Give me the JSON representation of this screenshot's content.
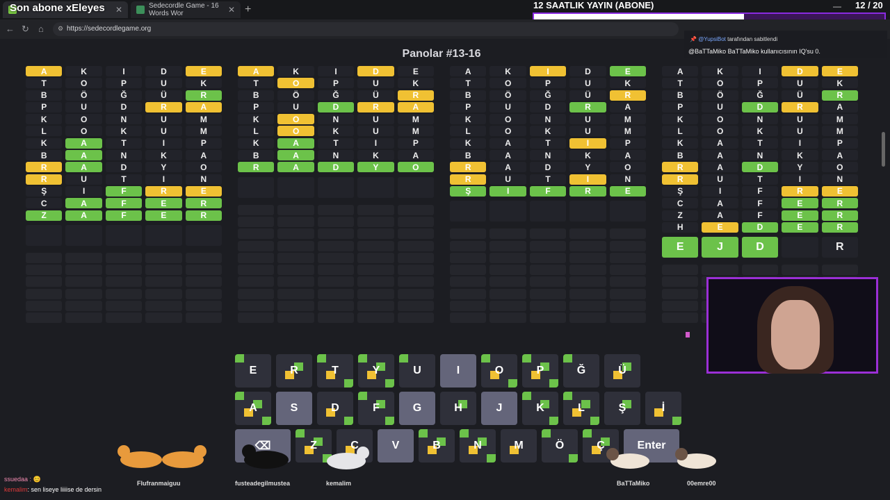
{
  "overlay_title": "Son abone xEleyes",
  "stream": {
    "title": "12 SAATLIK YAYIN (ABONE)",
    "counter": "12 / 20",
    "progress": 0.6
  },
  "tabs": [
    {
      "label": "Sedecordle Game - 16 Words Wor"
    }
  ],
  "url": "https://sedecordlegame.org",
  "page_title": "Panolar #13-16",
  "pinned": {
    "bot": "@YupsiBot",
    "suffix": "tarafından sabitlendi",
    "message": "@BaTTaMiko BaTTaMiko kullanıcısının IQ'su 0."
  },
  "chat": [
    {
      "user": "ssuedaa :",
      "text": "😊"
    },
    {
      "user": "kemalim",
      "text": ": sen liseye liiiise de dersin"
    }
  ],
  "cats": [
    "Flufranmaiguu",
    "fusteadegilmustea",
    "kemalim",
    "BaTTaMiko",
    "00emre00"
  ],
  "boards": [
    {
      "rows": [
        [
          [
            "A",
            "y"
          ],
          [
            "K",
            ""
          ],
          [
            "I",
            ""
          ],
          [
            "D",
            ""
          ],
          [
            "E",
            "y"
          ]
        ],
        [
          [
            "T",
            ""
          ],
          [
            "O",
            ""
          ],
          [
            "P",
            ""
          ],
          [
            "U",
            ""
          ],
          [
            "K",
            ""
          ]
        ],
        [
          [
            "B",
            ""
          ],
          [
            "Ö",
            ""
          ],
          [
            "Ğ",
            ""
          ],
          [
            "Ü",
            ""
          ],
          [
            "R",
            "g"
          ]
        ],
        [
          [
            "P",
            ""
          ],
          [
            "U",
            ""
          ],
          [
            "D",
            ""
          ],
          [
            "R",
            "y"
          ],
          [
            "A",
            "y"
          ]
        ],
        [
          [
            "K",
            ""
          ],
          [
            "O",
            ""
          ],
          [
            "N",
            ""
          ],
          [
            "U",
            ""
          ],
          [
            "M",
            ""
          ]
        ],
        [
          [
            "L",
            ""
          ],
          [
            "O",
            ""
          ],
          [
            "K",
            ""
          ],
          [
            "U",
            ""
          ],
          [
            "M",
            ""
          ]
        ],
        [
          [
            "K",
            ""
          ],
          [
            "A",
            "g"
          ],
          [
            "T",
            ""
          ],
          [
            "I",
            ""
          ],
          [
            "P",
            ""
          ]
        ],
        [
          [
            "B",
            ""
          ],
          [
            "A",
            "g"
          ],
          [
            "N",
            ""
          ],
          [
            "K",
            ""
          ],
          [
            "A",
            ""
          ]
        ],
        [
          [
            "R",
            "y"
          ],
          [
            "A",
            "g"
          ],
          [
            "D",
            ""
          ],
          [
            "Y",
            ""
          ],
          [
            "O",
            ""
          ]
        ],
        [
          [
            "R",
            "y"
          ],
          [
            "U",
            ""
          ],
          [
            "T",
            ""
          ],
          [
            "I",
            ""
          ],
          [
            "N",
            ""
          ]
        ],
        [
          [
            "Ş",
            ""
          ],
          [
            "I",
            ""
          ],
          [
            "F",
            "g"
          ],
          [
            "R",
            "y"
          ],
          [
            "E",
            "y"
          ]
        ],
        [
          [
            "C",
            ""
          ],
          [
            "A",
            "g"
          ],
          [
            "F",
            "g"
          ],
          [
            "E",
            "g"
          ],
          [
            "R",
            "g"
          ]
        ],
        [
          [
            "Z",
            "g"
          ],
          [
            "A",
            "g"
          ],
          [
            "F",
            "g"
          ],
          [
            "E",
            "g"
          ],
          [
            "R",
            "g"
          ]
        ]
      ]
    },
    {
      "rows": [
        [
          [
            "A",
            "y"
          ],
          [
            "K",
            ""
          ],
          [
            "I",
            ""
          ],
          [
            "D",
            "y"
          ],
          [
            "E",
            ""
          ]
        ],
        [
          [
            "T",
            ""
          ],
          [
            "O",
            "y"
          ],
          [
            "P",
            ""
          ],
          [
            "U",
            ""
          ],
          [
            "K",
            ""
          ]
        ],
        [
          [
            "B",
            ""
          ],
          [
            "Ö",
            ""
          ],
          [
            "Ğ",
            ""
          ],
          [
            "Ü",
            ""
          ],
          [
            "R",
            "y"
          ]
        ],
        [
          [
            "P",
            ""
          ],
          [
            "U",
            ""
          ],
          [
            "D",
            "g"
          ],
          [
            "R",
            "y"
          ],
          [
            "A",
            "y"
          ]
        ],
        [
          [
            "K",
            ""
          ],
          [
            "O",
            "y"
          ],
          [
            "N",
            ""
          ],
          [
            "U",
            ""
          ],
          [
            "M",
            ""
          ]
        ],
        [
          [
            "L",
            ""
          ],
          [
            "O",
            "y"
          ],
          [
            "K",
            ""
          ],
          [
            "U",
            ""
          ],
          [
            "M",
            ""
          ]
        ],
        [
          [
            "K",
            ""
          ],
          [
            "A",
            "g"
          ],
          [
            "T",
            ""
          ],
          [
            "I",
            ""
          ],
          [
            "P",
            ""
          ]
        ],
        [
          [
            "B",
            ""
          ],
          [
            "A",
            "g"
          ],
          [
            "N",
            ""
          ],
          [
            "K",
            ""
          ],
          [
            "A",
            ""
          ]
        ],
        [
          [
            "R",
            "g"
          ],
          [
            "A",
            "g"
          ],
          [
            "D",
            "g"
          ],
          [
            "Y",
            "g"
          ],
          [
            "O",
            "g"
          ]
        ]
      ]
    },
    {
      "rows": [
        [
          [
            "A",
            ""
          ],
          [
            "K",
            ""
          ],
          [
            "I",
            "y"
          ],
          [
            "D",
            ""
          ],
          [
            "E",
            "g"
          ]
        ],
        [
          [
            "T",
            ""
          ],
          [
            "O",
            ""
          ],
          [
            "P",
            ""
          ],
          [
            "U",
            ""
          ],
          [
            "K",
            ""
          ]
        ],
        [
          [
            "B",
            ""
          ],
          [
            "Ö",
            ""
          ],
          [
            "Ğ",
            ""
          ],
          [
            "Ü",
            ""
          ],
          [
            "R",
            "y"
          ]
        ],
        [
          [
            "P",
            ""
          ],
          [
            "U",
            ""
          ],
          [
            "D",
            ""
          ],
          [
            "R",
            "g"
          ],
          [
            "A",
            ""
          ]
        ],
        [
          [
            "K",
            ""
          ],
          [
            "O",
            ""
          ],
          [
            "N",
            ""
          ],
          [
            "U",
            ""
          ],
          [
            "M",
            ""
          ]
        ],
        [
          [
            "L",
            ""
          ],
          [
            "O",
            ""
          ],
          [
            "K",
            ""
          ],
          [
            "U",
            ""
          ],
          [
            "M",
            ""
          ]
        ],
        [
          [
            "K",
            ""
          ],
          [
            "A",
            ""
          ],
          [
            "T",
            ""
          ],
          [
            "I",
            "y"
          ],
          [
            "P",
            ""
          ]
        ],
        [
          [
            "B",
            ""
          ],
          [
            "A",
            ""
          ],
          [
            "N",
            ""
          ],
          [
            "K",
            ""
          ],
          [
            "A",
            ""
          ]
        ],
        [
          [
            "R",
            "y"
          ],
          [
            "A",
            ""
          ],
          [
            "D",
            ""
          ],
          [
            "Y",
            ""
          ],
          [
            "O",
            ""
          ]
        ],
        [
          [
            "R",
            "y"
          ],
          [
            "U",
            ""
          ],
          [
            "T",
            ""
          ],
          [
            "I",
            "y"
          ],
          [
            "N",
            ""
          ]
        ],
        [
          [
            "Ş",
            "g"
          ],
          [
            "I",
            "g"
          ],
          [
            "F",
            "g"
          ],
          [
            "R",
            "g"
          ],
          [
            "E",
            "g"
          ]
        ]
      ]
    },
    {
      "rows": [
        [
          [
            "A",
            ""
          ],
          [
            "K",
            ""
          ],
          [
            "I",
            ""
          ],
          [
            "D",
            "y"
          ],
          [
            "E",
            "y"
          ]
        ],
        [
          [
            "T",
            ""
          ],
          [
            "O",
            ""
          ],
          [
            "P",
            ""
          ],
          [
            "U",
            ""
          ],
          [
            "K",
            ""
          ]
        ],
        [
          [
            "B",
            ""
          ],
          [
            "Ö",
            ""
          ],
          [
            "Ğ",
            ""
          ],
          [
            "Ü",
            ""
          ],
          [
            "R",
            "g"
          ]
        ],
        [
          [
            "P",
            ""
          ],
          [
            "U",
            ""
          ],
          [
            "D",
            "g"
          ],
          [
            "R",
            "y"
          ],
          [
            "A",
            ""
          ]
        ],
        [
          [
            "K",
            ""
          ],
          [
            "O",
            ""
          ],
          [
            "N",
            ""
          ],
          [
            "U",
            ""
          ],
          [
            "M",
            ""
          ]
        ],
        [
          [
            "L",
            ""
          ],
          [
            "O",
            ""
          ],
          [
            "K",
            ""
          ],
          [
            "U",
            ""
          ],
          [
            "M",
            ""
          ]
        ],
        [
          [
            "K",
            ""
          ],
          [
            "A",
            ""
          ],
          [
            "T",
            ""
          ],
          [
            "I",
            ""
          ],
          [
            "P",
            ""
          ]
        ],
        [
          [
            "B",
            ""
          ],
          [
            "A",
            ""
          ],
          [
            "N",
            ""
          ],
          [
            "K",
            ""
          ],
          [
            "A",
            ""
          ]
        ],
        [
          [
            "R",
            "y"
          ],
          [
            "A",
            ""
          ],
          [
            "D",
            "g"
          ],
          [
            "Y",
            ""
          ],
          [
            "O",
            ""
          ]
        ],
        [
          [
            "R",
            "y"
          ],
          [
            "U",
            ""
          ],
          [
            "T",
            ""
          ],
          [
            "I",
            ""
          ],
          [
            "N",
            ""
          ]
        ],
        [
          [
            "Ş",
            ""
          ],
          [
            "I",
            ""
          ],
          [
            "F",
            ""
          ],
          [
            "R",
            "y"
          ],
          [
            "E",
            "y"
          ]
        ],
        [
          [
            "C",
            ""
          ],
          [
            "A",
            ""
          ],
          [
            "F",
            ""
          ],
          [
            "E",
            "g"
          ],
          [
            "R",
            "g"
          ]
        ],
        [
          [
            "Z",
            ""
          ],
          [
            "A",
            ""
          ],
          [
            "F",
            ""
          ],
          [
            "E",
            "g"
          ],
          [
            "R",
            "g"
          ]
        ],
        [
          [
            "H",
            ""
          ],
          [
            "E",
            "y"
          ],
          [
            "D",
            "g"
          ],
          [
            "E",
            "g"
          ],
          [
            "R",
            "g"
          ]
        ]
      ],
      "current": [
        [
          "E",
          "g"
        ],
        [
          "J",
          "g"
        ],
        [
          "D",
          "g"
        ],
        [
          "",
          ""
        ],
        [
          "R",
          ""
        ]
      ]
    }
  ],
  "keyboard": [
    [
      [
        "E",
        "d"
      ],
      [
        "R",
        "d"
      ],
      [
        "T",
        "d"
      ],
      [
        "Y",
        "d"
      ],
      [
        "U",
        "d"
      ],
      [
        "I",
        "l"
      ],
      [
        "O",
        "d"
      ],
      [
        "P",
        "d"
      ],
      [
        "Ğ",
        "d"
      ],
      [
        "Ü",
        "d"
      ]
    ],
    [
      [
        "A",
        "d"
      ],
      [
        "S",
        "l"
      ],
      [
        "D",
        "d"
      ],
      [
        "F",
        "d"
      ],
      [
        "G",
        "l"
      ],
      [
        "H",
        "d"
      ],
      [
        "J",
        "l"
      ],
      [
        "K",
        "d"
      ],
      [
        "L",
        "d"
      ],
      [
        "Ş",
        "d"
      ],
      [
        "İ",
        "d"
      ]
    ],
    [
      [
        "⌫",
        "l"
      ],
      [
        "Z",
        "d"
      ],
      [
        "C",
        "d"
      ],
      [
        "V",
        "l"
      ],
      [
        "B",
        "d"
      ],
      [
        "N",
        "d"
      ],
      [
        "M",
        "d"
      ],
      [
        "Ö",
        "d"
      ],
      [
        "Ç",
        "d"
      ],
      [
        "Enter",
        "l"
      ]
    ]
  ],
  "colors": {
    "green": "#6cc24a",
    "yellow": "#f0c133",
    "twitch": "#9b2fd6"
  }
}
